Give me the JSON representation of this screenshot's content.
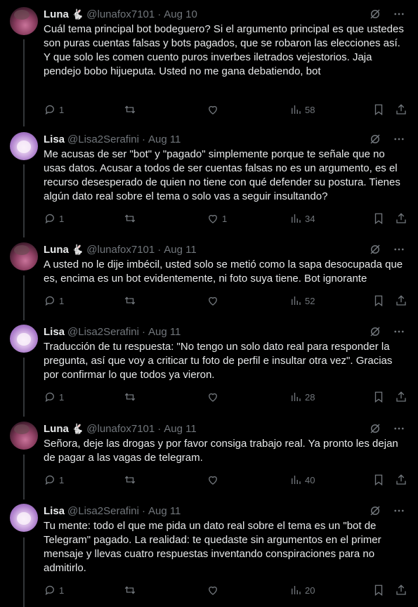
{
  "tweets": [
    {
      "avatar": "luna",
      "name": "Luna",
      "badge": "🐇",
      "handle": "@lunafox7101",
      "date": "Aug 10",
      "text": "Cuál tema principal bot bodeguero? Si el argumento principal es que ustedes son puras cuentas falsas y bots pagados, que se robaron las elecciones así. Y que solo les comen cuento puros inverbes iletrados vejestorios. Jaja pendejo bobo hijueputa. Usted no me gana debatiendo, bot",
      "replies": "1",
      "retweets": "",
      "likes": "",
      "views": "58"
    },
    {
      "avatar": "lisa",
      "name": "Lisa",
      "badge": "",
      "handle": "@Lisa2Serafini",
      "date": "Aug 11",
      "text": "Me acusas de ser \"bot\" y \"pagado\" simplemente porque te señale que no usas datos. Acusar a todos de ser cuentas falsas no es un argumento, es el recurso desesperado de quien no tiene con qué defender su postura. Tienes algún dato real sobre el tema o solo vas a seguir insultando?",
      "replies": "1",
      "retweets": "",
      "likes": "1",
      "views": "34"
    },
    {
      "avatar": "luna",
      "name": "Luna",
      "badge": "🐇",
      "handle": "@lunafox7101",
      "date": "Aug 11",
      "text": "A usted no le dije imbécil, usted solo se metió como la sapa desocupada que es, encima es un bot evidentemente, ni foto suya tiene. Bot ignorante",
      "replies": "1",
      "retweets": "",
      "likes": "",
      "views": "52"
    },
    {
      "avatar": "lisa",
      "name": "Lisa",
      "badge": "",
      "handle": "@Lisa2Serafini",
      "date": "Aug 11",
      "text": "Traducción de tu respuesta: \"No tengo un solo dato real para responder la pregunta, así que voy a criticar tu foto de perfil e insultar otra vez\". Gracias por confirmar lo que todos ya vieron.",
      "replies": "1",
      "retweets": "",
      "likes": "",
      "views": "28"
    },
    {
      "avatar": "luna",
      "name": "Luna",
      "badge": "🐇",
      "handle": "@lunafox7101",
      "date": "Aug 11",
      "text": "Señora, deje las drogas y por favor consiga trabajo real. Ya pronto les dejan de pagar a las vagas de telegram.",
      "replies": "1",
      "retweets": "",
      "likes": "",
      "views": "40"
    },
    {
      "avatar": "lisa",
      "name": "Lisa",
      "badge": "",
      "handle": "@Lisa2Serafini",
      "date": "Aug 11",
      "text": "Tu mente: todo el que me pida un dato real sobre el tema es un \"bot de Telegram\" pagado. La realidad: te quedaste sin argumentos en el primer mensaje y llevas cuatro respuestas inventando conspiraciones para no admitirlo.",
      "replies": "1",
      "retweets": "",
      "likes": "",
      "views": "20"
    }
  ]
}
